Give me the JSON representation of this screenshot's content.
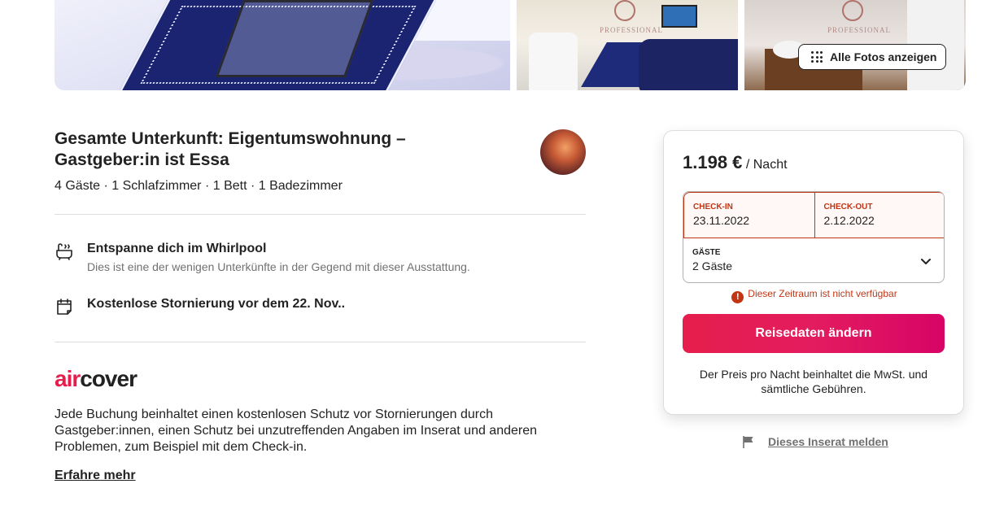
{
  "gallery": {
    "show_all_label": "Alle Fotos anzeigen",
    "watermark_text": "PROFESSIONAL"
  },
  "listing": {
    "title": "Gesamte Unterkunft: Eigentumswohnung – Gastgeber:in ist Essa",
    "summary": "4 Gäste · 1 Schlafzimmer · 1 Bett · 1 Badezimmer",
    "host_avatar_icon": "host-avatar"
  },
  "highlights": [
    {
      "icon": "bathtub-icon",
      "title": "Entspanne dich im Whirlpool",
      "description": "Dies ist eine der wenigen Unterkünfte in der Gegend mit dieser Ausstattung."
    },
    {
      "icon": "calendar-icon",
      "title": "Kostenlose Stornierung vor dem 22. Nov..",
      "description": ""
    }
  ],
  "aircover": {
    "brand_air": "air",
    "brand_cover": "cover",
    "text": "Jede Buchung beinhaltet einen kostenlosen Schutz vor Stornierungen durch Gastgeber:innen, einen Schutz bei unzutreffenden Angaben im Inserat und anderen Problemen, zum Beispiel mit dem Check-in.",
    "learn_more": "Erfahre mehr"
  },
  "booking": {
    "price": "1.198 €",
    "per_night": "/ Nacht",
    "checkin_label": "CHECK-IN",
    "checkin_value": "23.11.2022",
    "checkout_label": "CHECK-OUT",
    "checkout_value": "2.12.2022",
    "guests_label": "GÄSTE",
    "guests_value": "2 Gäste",
    "error": "Dieser Zeitraum ist nicht verfügbar",
    "cta": "Reisedaten ändern",
    "note": "Der Preis pro Nacht beinhaltet die MwSt. und sämtliche Gebühren."
  },
  "report": {
    "label": "Dieses Inserat melden"
  },
  "colors": {
    "brand": "#e61e4d",
    "error": "#c13515",
    "text": "#222222",
    "muted": "#717171"
  }
}
